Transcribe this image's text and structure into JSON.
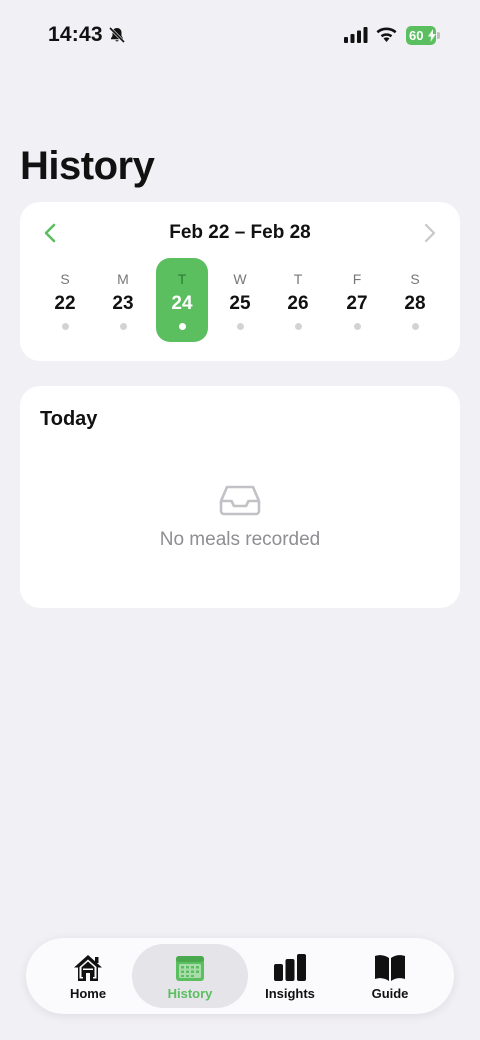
{
  "status_bar": {
    "time": "14:43",
    "battery": "60"
  },
  "page": {
    "title": "History"
  },
  "week": {
    "range": "Feb 22 – Feb 28",
    "days": [
      {
        "dow": "S",
        "num": "22"
      },
      {
        "dow": "M",
        "num": "23"
      },
      {
        "dow": "T",
        "num": "24"
      },
      {
        "dow": "W",
        "num": "25"
      },
      {
        "dow": "T",
        "num": "26"
      },
      {
        "dow": "F",
        "num": "27"
      },
      {
        "dow": "S",
        "num": "28"
      }
    ],
    "selected_index": 2
  },
  "today": {
    "title": "Today",
    "empty_text": "No meals recorded"
  },
  "tabs": [
    {
      "label": "Home",
      "icon": "house-icon"
    },
    {
      "label": "History",
      "icon": "calendar-icon"
    },
    {
      "label": "Insights",
      "icon": "bar-chart-icon"
    },
    {
      "label": "Guide",
      "icon": "book-icon"
    }
  ],
  "colors": {
    "accent": "#5bbf5f",
    "background": "#f1f0f5",
    "card": "#ffffff",
    "muted_text": "#8e8e93"
  }
}
